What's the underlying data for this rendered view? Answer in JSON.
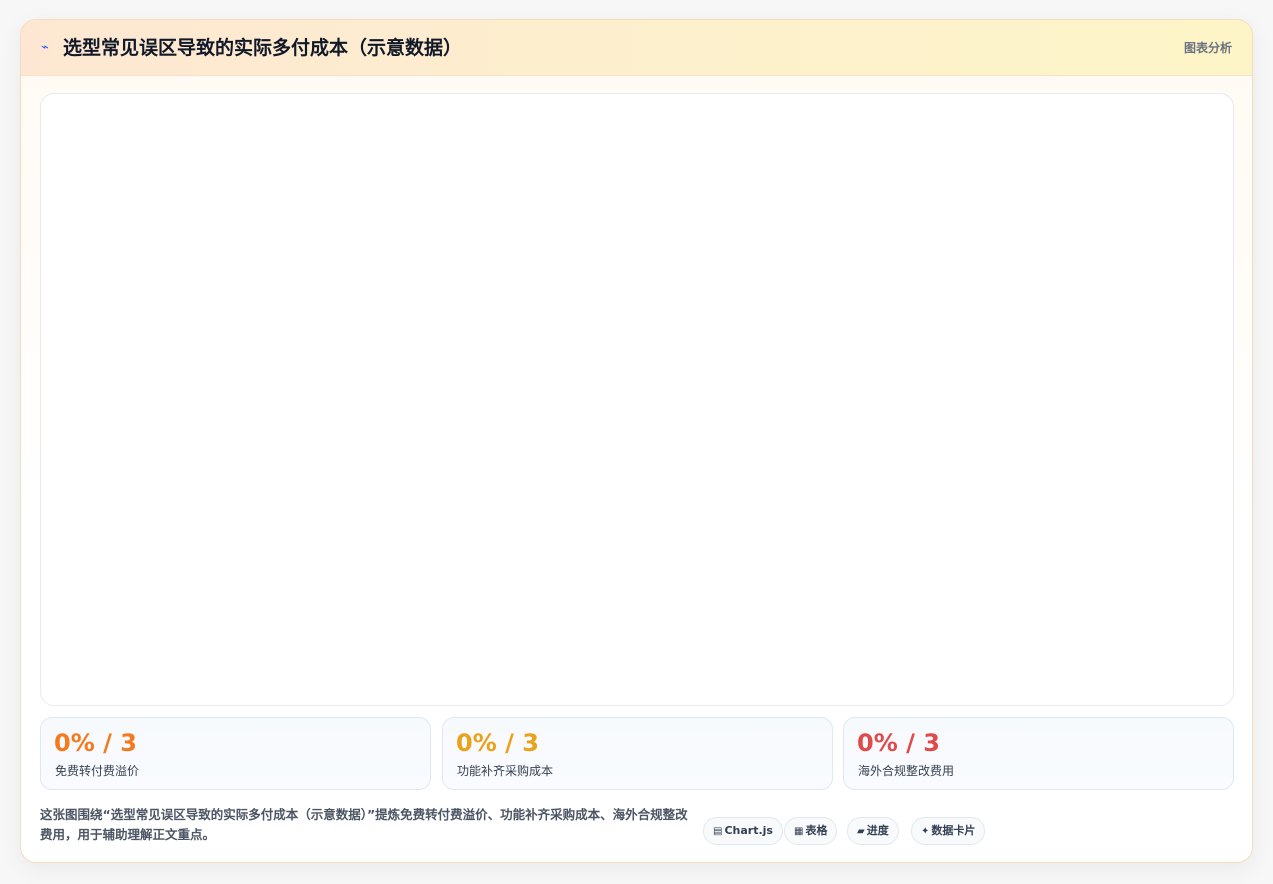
{
  "header": {
    "icon": "chart-trend-icon",
    "title": "选型常见误区导致的实际多付成本（示意数据）",
    "tag": "图表分析"
  },
  "chart_data": {
    "type": "bar",
    "title": "",
    "categories": [],
    "values": []
  },
  "stats": [
    {
      "value": "0% / 3",
      "label": "免费转付费溢价",
      "color": "#f47a1f"
    },
    {
      "value": "0% / 3",
      "label": "功能补齐采购成本",
      "color": "#eaa21b"
    },
    {
      "value": "0% / 3",
      "label": "海外合规整改费用",
      "color": "#e14a4a"
    }
  ],
  "footer": {
    "description": "这张图围绕“选型常见误区导致的实际多付成本（示意数据）”提炼免费转付费溢价、功能补齐采购成本、海外合规整改费用，用于辅助理解正文重点。",
    "chips": [
      {
        "icon": "▤",
        "icon_name": "chart-icon",
        "label": "Chart.js"
      },
      {
        "icon": "▦",
        "icon_name": "table-icon",
        "label": "表格"
      },
      {
        "icon": "▰",
        "icon_name": "progress-icon",
        "label": "进度"
      },
      {
        "icon": "✦",
        "icon_name": "sparkle-icon",
        "label": "数据卡片"
      }
    ]
  }
}
